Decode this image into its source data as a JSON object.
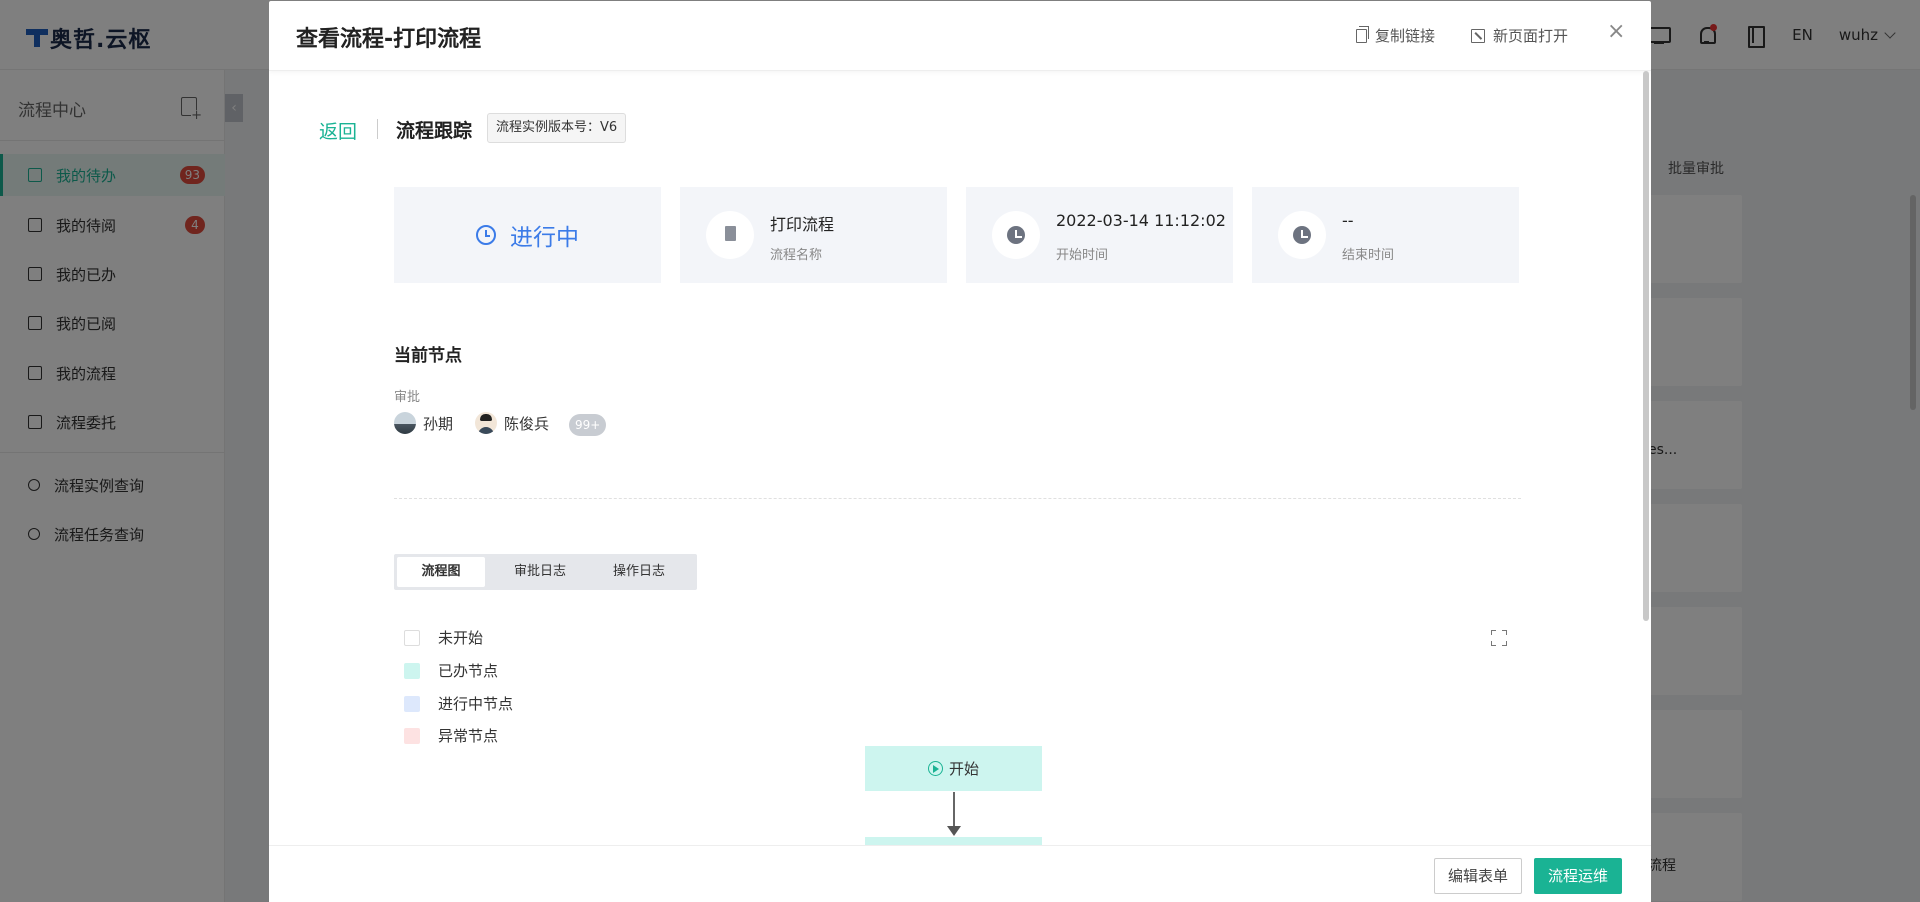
{
  "app": {
    "logo_text": "奥哲.云枢",
    "lang": "EN",
    "user": "wuhz"
  },
  "sidebar": {
    "title": "流程中心",
    "items": [
      {
        "label": "我的待办",
        "badge": "93"
      },
      {
        "label": "我的待阅",
        "badge": "4"
      },
      {
        "label": "我的已办"
      },
      {
        "label": "我的已阅"
      },
      {
        "label": "我的流程"
      },
      {
        "label": "流程委托"
      },
      {
        "label": "流程实例查询"
      },
      {
        "label": "流程任务查询"
      }
    ]
  },
  "background": {
    "batch_label": "批量审批",
    "card_texts": [
      "es...",
      "流程"
    ]
  },
  "modal": {
    "title": "查看流程-打印流程",
    "copy_link": "复制链接",
    "open_new_page": "新页面打开",
    "close": "×",
    "back": "返回",
    "subtitle": "流程跟踪",
    "version_tag": "流程实例版本号：V6",
    "status": "进行中",
    "info": {
      "process_name": {
        "value": "打印流程",
        "label": "流程名称"
      },
      "start_time": {
        "value": "2022-03-14 11:12:02",
        "label": "开始时间"
      },
      "end_time": {
        "value": "--",
        "label": "结束时间"
      }
    },
    "current_node": {
      "title": "当前节点",
      "type": "审批",
      "people": [
        "孙期",
        "陈俊兵"
      ],
      "more": "99+"
    },
    "tabs": [
      "流程图",
      "审批日志",
      "操作日志"
    ],
    "legend": [
      {
        "label": "未开始",
        "color": "#ffffff"
      },
      {
        "label": "已办节点",
        "color": "#cdf5ef"
      },
      {
        "label": "进行中节点",
        "color": "#dde8fc"
      },
      {
        "label": "异常节点",
        "color": "#fde2e2"
      }
    ],
    "flow": {
      "start_node": "开始"
    },
    "footer": {
      "edit_form": "编辑表单",
      "ops": "流程运维"
    }
  },
  "colors": {
    "primary": "#1ab394",
    "status_blue": "#3b7be8",
    "badge_red": "#e04b3c"
  }
}
